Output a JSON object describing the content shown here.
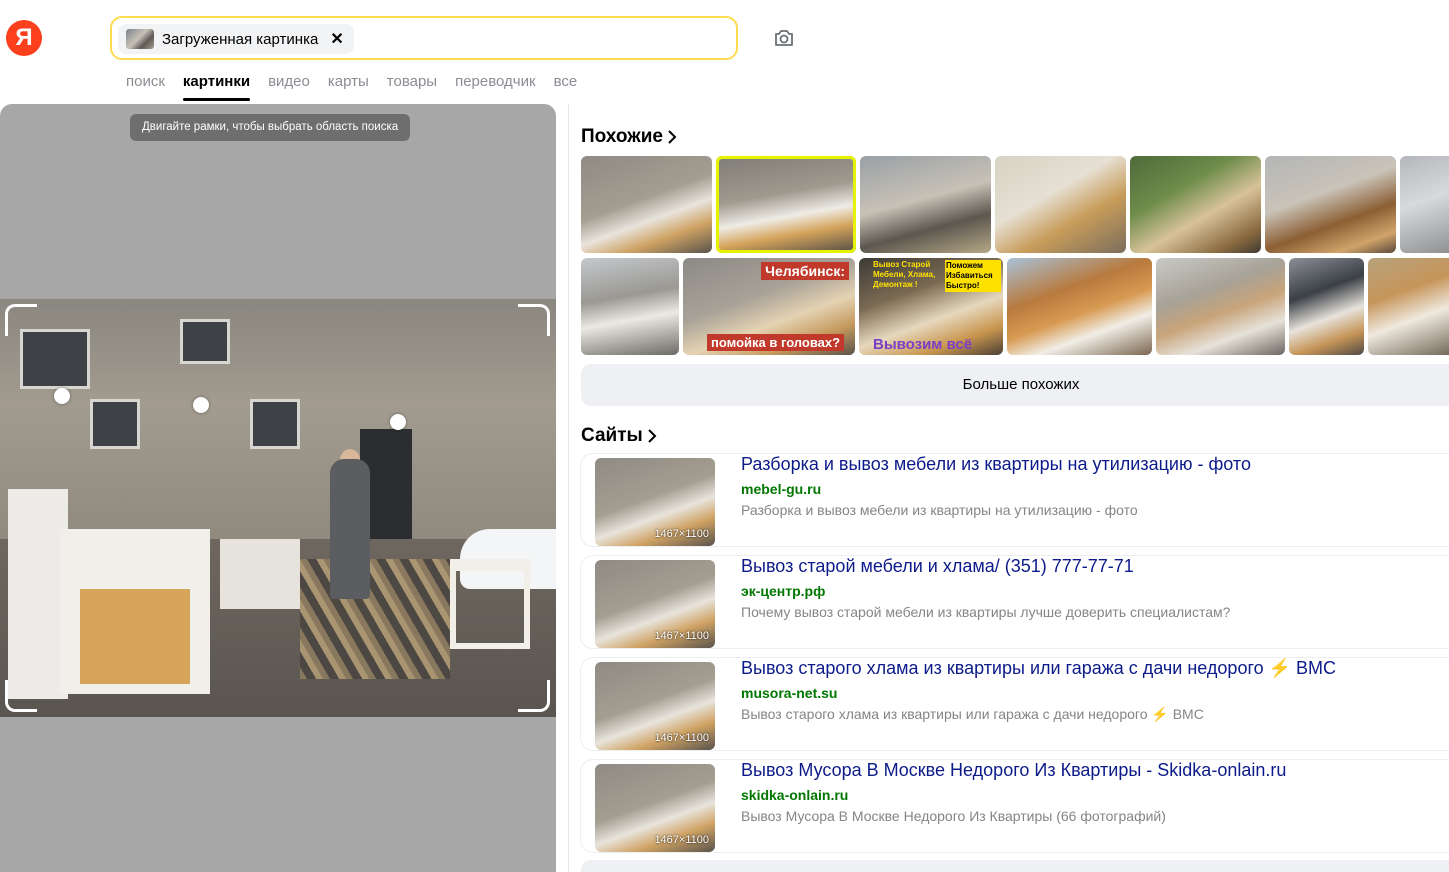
{
  "header": {
    "logo": "Я",
    "search_chip_label": "Загруженная картинка",
    "chip_close": "✕",
    "camera_icon": "camera-icon"
  },
  "tabs": [
    {
      "label": "поиск",
      "active": false
    },
    {
      "label": "картинки",
      "active": true
    },
    {
      "label": "видео",
      "active": false
    },
    {
      "label": "карты",
      "active": false
    },
    {
      "label": "товары",
      "active": false
    },
    {
      "label": "переводчик",
      "active": false
    },
    {
      "label": "все",
      "active": false
    }
  ],
  "preview": {
    "hint": "Двигайте рамки, чтобы выбрать область поиска"
  },
  "similar": {
    "title": "Похожие",
    "overlay_texts": {
      "chelyabinsk": "Челябинск:",
      "pomoyka": "помойка в головах?",
      "vyvoz_small": "Вывоз Старой Мебели, Хлама, Демонтаж !",
      "pomozhem": "Поможем Избавиться Быстро!",
      "vyvozim": "Вывозим всё"
    },
    "more_button": "Больше похожих"
  },
  "sites": {
    "title": "Сайты",
    "items": [
      {
        "title": "Разборка и вывоз мебели из квартиры на утилизацию - фото",
        "domain": "mebel-gu.ru",
        "description": "Разборка и вывоз мебели из квартиры на утилизацию - фото",
        "size": "1467×1100"
      },
      {
        "title": "Вывоз старой мебели и хлама/ (351) 777-77-71",
        "domain": "эк-центр.рф",
        "description": "Почему вывоз старой мебели из квартиры лучше доверить специалистам?",
        "size": "1467×1100"
      },
      {
        "title": "Вывоз старого хлама из квартиры или гаража с дачи недорого ⚡ ВМС",
        "domain": "musora-net.su",
        "description": "Вывоз старого хлама из квартиры или гаража с дачи недорого ⚡ ВМС",
        "size": "1467×1100"
      },
      {
        "title": "Вывоз Мусора В Москве Недорого Из Квартиры - Skidka-onlain.ru",
        "domain": "skidka-onlain.ru",
        "description": "Вывоз Мусора В Москве Недорого Из Квартиры (66 фотографий)",
        "size": "1467×1100"
      }
    ]
  },
  "colors": {
    "logo": "#fc3f1d",
    "search_border": "#ffdb4d",
    "link": "#0d1b8a",
    "domain": "#007700",
    "selected_outline": "#e5f200"
  }
}
